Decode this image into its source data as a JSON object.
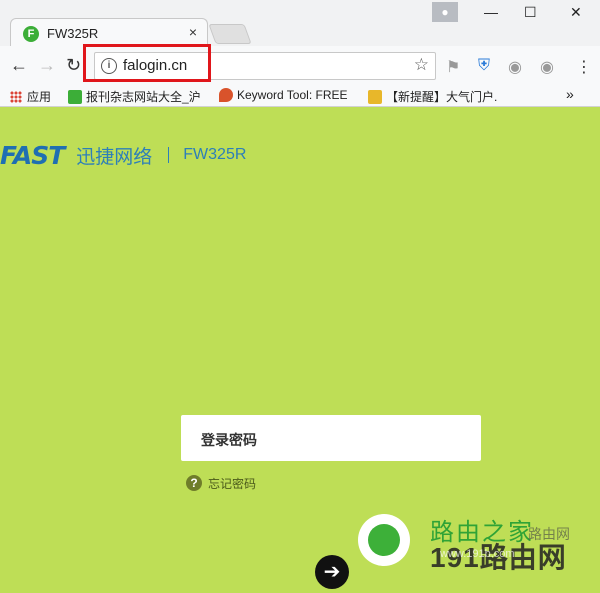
{
  "browser": {
    "tab": {
      "favicon_letter": "F",
      "title": "FW325R",
      "close": "×"
    },
    "profile_icon": "person-icon",
    "window_controls": {
      "minimize": "—",
      "maximize": "☐",
      "close": "✕"
    },
    "nav": {
      "back": "←",
      "forward": "→",
      "reload": "↻"
    },
    "address": {
      "info": "i",
      "url": "falogin.cn",
      "star": "☆"
    },
    "menu": "⋮",
    "bookmarks": {
      "apps": "应用",
      "item1": "报刊杂志网站大全_沪",
      "item2": "Keyword Tool: FREE",
      "item3": "【新提醒】大气门户.",
      "more": "»"
    }
  },
  "page": {
    "brand_logo": "FAST",
    "brand_cn": "迅捷网络",
    "model": "FW325R",
    "password_placeholder": "登录密码",
    "forgot_icon": "?",
    "forgot_label": "忘记密码",
    "login_arrow": "➔",
    "watermark": {
      "line1": "路由之家",
      "line2": "191路由网",
      "url": "www.191b.com",
      "side": "路由网"
    }
  },
  "colors": {
    "page_bg": "#bede56",
    "brand_blue": "#2d7fb8",
    "highlight_red": "#e0161b"
  }
}
